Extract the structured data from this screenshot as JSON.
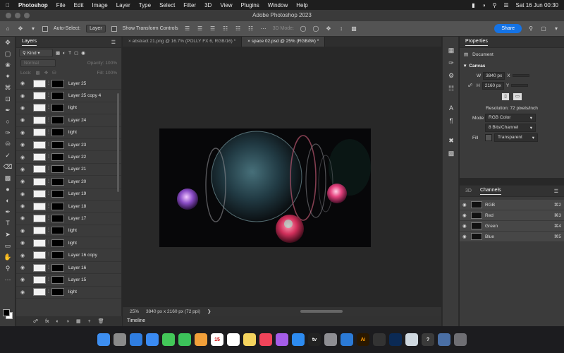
{
  "menubar": {
    "apple": "",
    "app": "Photoshop",
    "items": [
      "File",
      "Edit",
      "Image",
      "Layer",
      "Type",
      "Select",
      "Filter",
      "3D",
      "View",
      "Plugins",
      "Window",
      "Help"
    ],
    "clock": "Sat 16 Jun  00:30"
  },
  "window": {
    "title": "Adobe Photoshop 2023"
  },
  "options": {
    "auto_select_label": "Auto-Select:",
    "auto_select_value": "Layer",
    "transform_label": "Show Transform Controls",
    "mode_3d": "3D Mode:",
    "share": "Share"
  },
  "layers_panel": {
    "tab": "Layers",
    "filter": "Kind",
    "blend": "Normal",
    "opacity": "Opacity: 100%",
    "lock": "Lock:",
    "fill": "Fill: 100%",
    "layers": [
      "Layer 25",
      "Layer 25 copy 4",
      "light",
      "Layer 24",
      "light",
      "Layer 23",
      "Layer 22",
      "Layer 21",
      "Layer 20",
      "Layer 19",
      "Layer 18",
      "Layer 17",
      "light",
      "light",
      "Layer 16 copy",
      "Layer 16",
      "Layer 15",
      "light"
    ]
  },
  "documents": {
    "tabs": [
      {
        "label": "abstract 21.png @ 16.7% (POLLY FX 6, RGB/16) *",
        "active": false
      },
      {
        "label": "space 02.psd @ 25% (RGB/8#) *",
        "active": true
      }
    ],
    "zoom": "25%",
    "size_info": "3840 px x 2160 px (72 ppi)",
    "timeline": "Timeline"
  },
  "properties": {
    "tab": "Properties",
    "document": "Document",
    "section": "Canvas",
    "w_label": "W",
    "w_value": "3840 px",
    "h_label": "H",
    "h_value": "2160 px",
    "x_label": "X",
    "y_label": "Y",
    "resolution": "Resolution: 72 pixels/inch",
    "mode_label": "Mode",
    "mode_value": "RGB Color",
    "depth_value": "8 Bits/Channel",
    "fill_label": "Fill",
    "fill_value": "Transparent"
  },
  "channels_panel": {
    "tab_3d": "3D",
    "tab": "Channels",
    "channels": [
      {
        "name": "RGB",
        "shortcut": "⌘2"
      },
      {
        "name": "Red",
        "shortcut": "⌘3"
      },
      {
        "name": "Green",
        "shortcut": "⌘4"
      },
      {
        "name": "Blue",
        "shortcut": "⌘5"
      }
    ]
  },
  "dock": {
    "icons": [
      "finder-icon",
      "launchpad-icon",
      "safari-icon",
      "mail-icon",
      "messages-icon",
      "facetime-icon",
      "photos-icon",
      "calendar-icon",
      "reminders-icon",
      "notes-icon",
      "music-icon",
      "podcasts-icon",
      "appstore-icon",
      "tv-icon",
      "settings-icon",
      "vscode-icon",
      "illustrator-icon",
      "cinema4d-icon",
      "photoshop-icon",
      "preview-icon",
      "help-icon",
      "downloads-icon",
      "trash-icon"
    ],
    "calendar_day": "15",
    "tv_label": "tv",
    "illustrator_label": "Ai"
  },
  "colors": {
    "accent": "#1473e6",
    "panel": "#3b3b3b",
    "canvas_bg": "#282828"
  }
}
